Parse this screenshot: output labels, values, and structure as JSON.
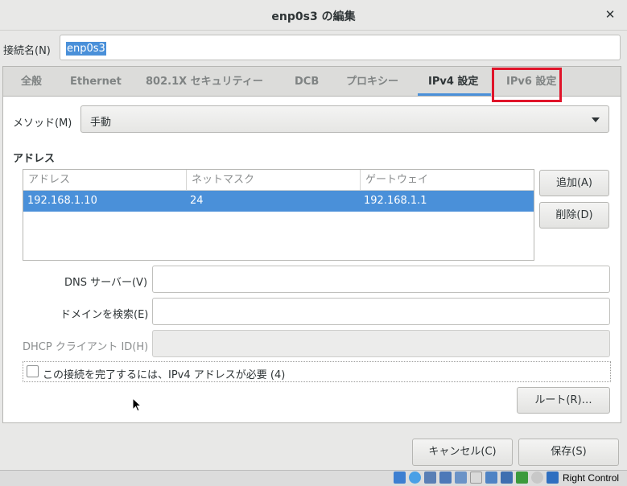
{
  "window": {
    "title": "enp0s3 の編集"
  },
  "connection": {
    "name_label": "接続名(N)",
    "name_value": "enp0s3"
  },
  "tabs": [
    {
      "label": "全般"
    },
    {
      "label": "Ethernet"
    },
    {
      "label": "802.1X セキュリティー"
    },
    {
      "label": "DCB"
    },
    {
      "label": "プロキシー"
    },
    {
      "label": "IPv4 設定"
    },
    {
      "label": "IPv6 設定"
    }
  ],
  "active_tab": "IPv4 設定",
  "method": {
    "label": "メソッド(M)",
    "value": "手動"
  },
  "addresses": {
    "section_title": "アドレス",
    "columns": [
      "アドレス",
      "ネットマスク",
      "ゲートウェイ"
    ],
    "rows": [
      [
        "192.168.1.10",
        "24",
        "192.168.1.1"
      ]
    ],
    "add_button": "追加(A)",
    "delete_button": "削除(D)"
  },
  "fields": {
    "dns_label": "DNS サーバー(V)",
    "dns_value": "",
    "search_label": "ドメインを検索(E)",
    "search_value": "",
    "dhcp_label": "DHCP クライアント ID(H)",
    "dhcp_value": ""
  },
  "require_ipv4": {
    "label": "この接続を完了するには、IPv4 アドレスが必要 (4)",
    "checked": false
  },
  "routes_button": "ルート(R)…",
  "footer": {
    "cancel": "キャンセル(C)",
    "save": "保存(S)"
  },
  "statusbar": {
    "host_key": "Right Control"
  },
  "colors": {
    "accent": "#4a90d9",
    "highlight": "#e0142a"
  }
}
